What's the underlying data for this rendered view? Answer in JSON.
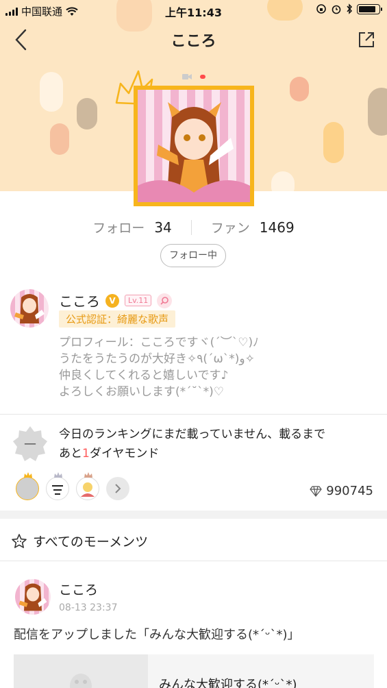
{
  "status_bar": {
    "carrier": "中国联通",
    "time": "上午11:43",
    "battery_fill": 0.85
  },
  "nav": {
    "title": "こころ"
  },
  "stats": {
    "follow_label": "フォロー",
    "follow_count": "34",
    "fan_label": "ファン",
    "fan_count": "1469",
    "follow_button": "フォロー中"
  },
  "profile": {
    "name": "こころ",
    "verified_mark": "V",
    "level": "Lv.11",
    "official_label": "公式認証：綺麗な歌声",
    "bio_lines": [
      "プロフィール：こころですヾ(´︶`♡)ﾉ",
      "うたをうたうのが大好き✧٩(ˊωˋ*)و✧",
      "仲良くしてくれると嬉しいです♪",
      "よろしくお願いします(*´˘`*)♡"
    ]
  },
  "ranking": {
    "badge": "—",
    "line1": "今日のランキングにまだ載っていません、載るまで",
    "line2_prefix": "あと",
    "line2_number": "1",
    "line2_suffix": "ダイヤモンド",
    "diamonds": "990745"
  },
  "moments": {
    "section_title": "すべてのモーメンツ",
    "post": {
      "author": "こころ",
      "timestamp": "08-13 23:37",
      "text": "配信をアップしました「みんな大歓迎する(*´ᵕ`*)」",
      "card_title": "みんな大歓迎する(*´ᵕ`*)"
    }
  },
  "colors": {
    "banner": "#fde6c3",
    "accent_gold": "#f7b51c",
    "highlight_red": "#ff5a5a"
  }
}
